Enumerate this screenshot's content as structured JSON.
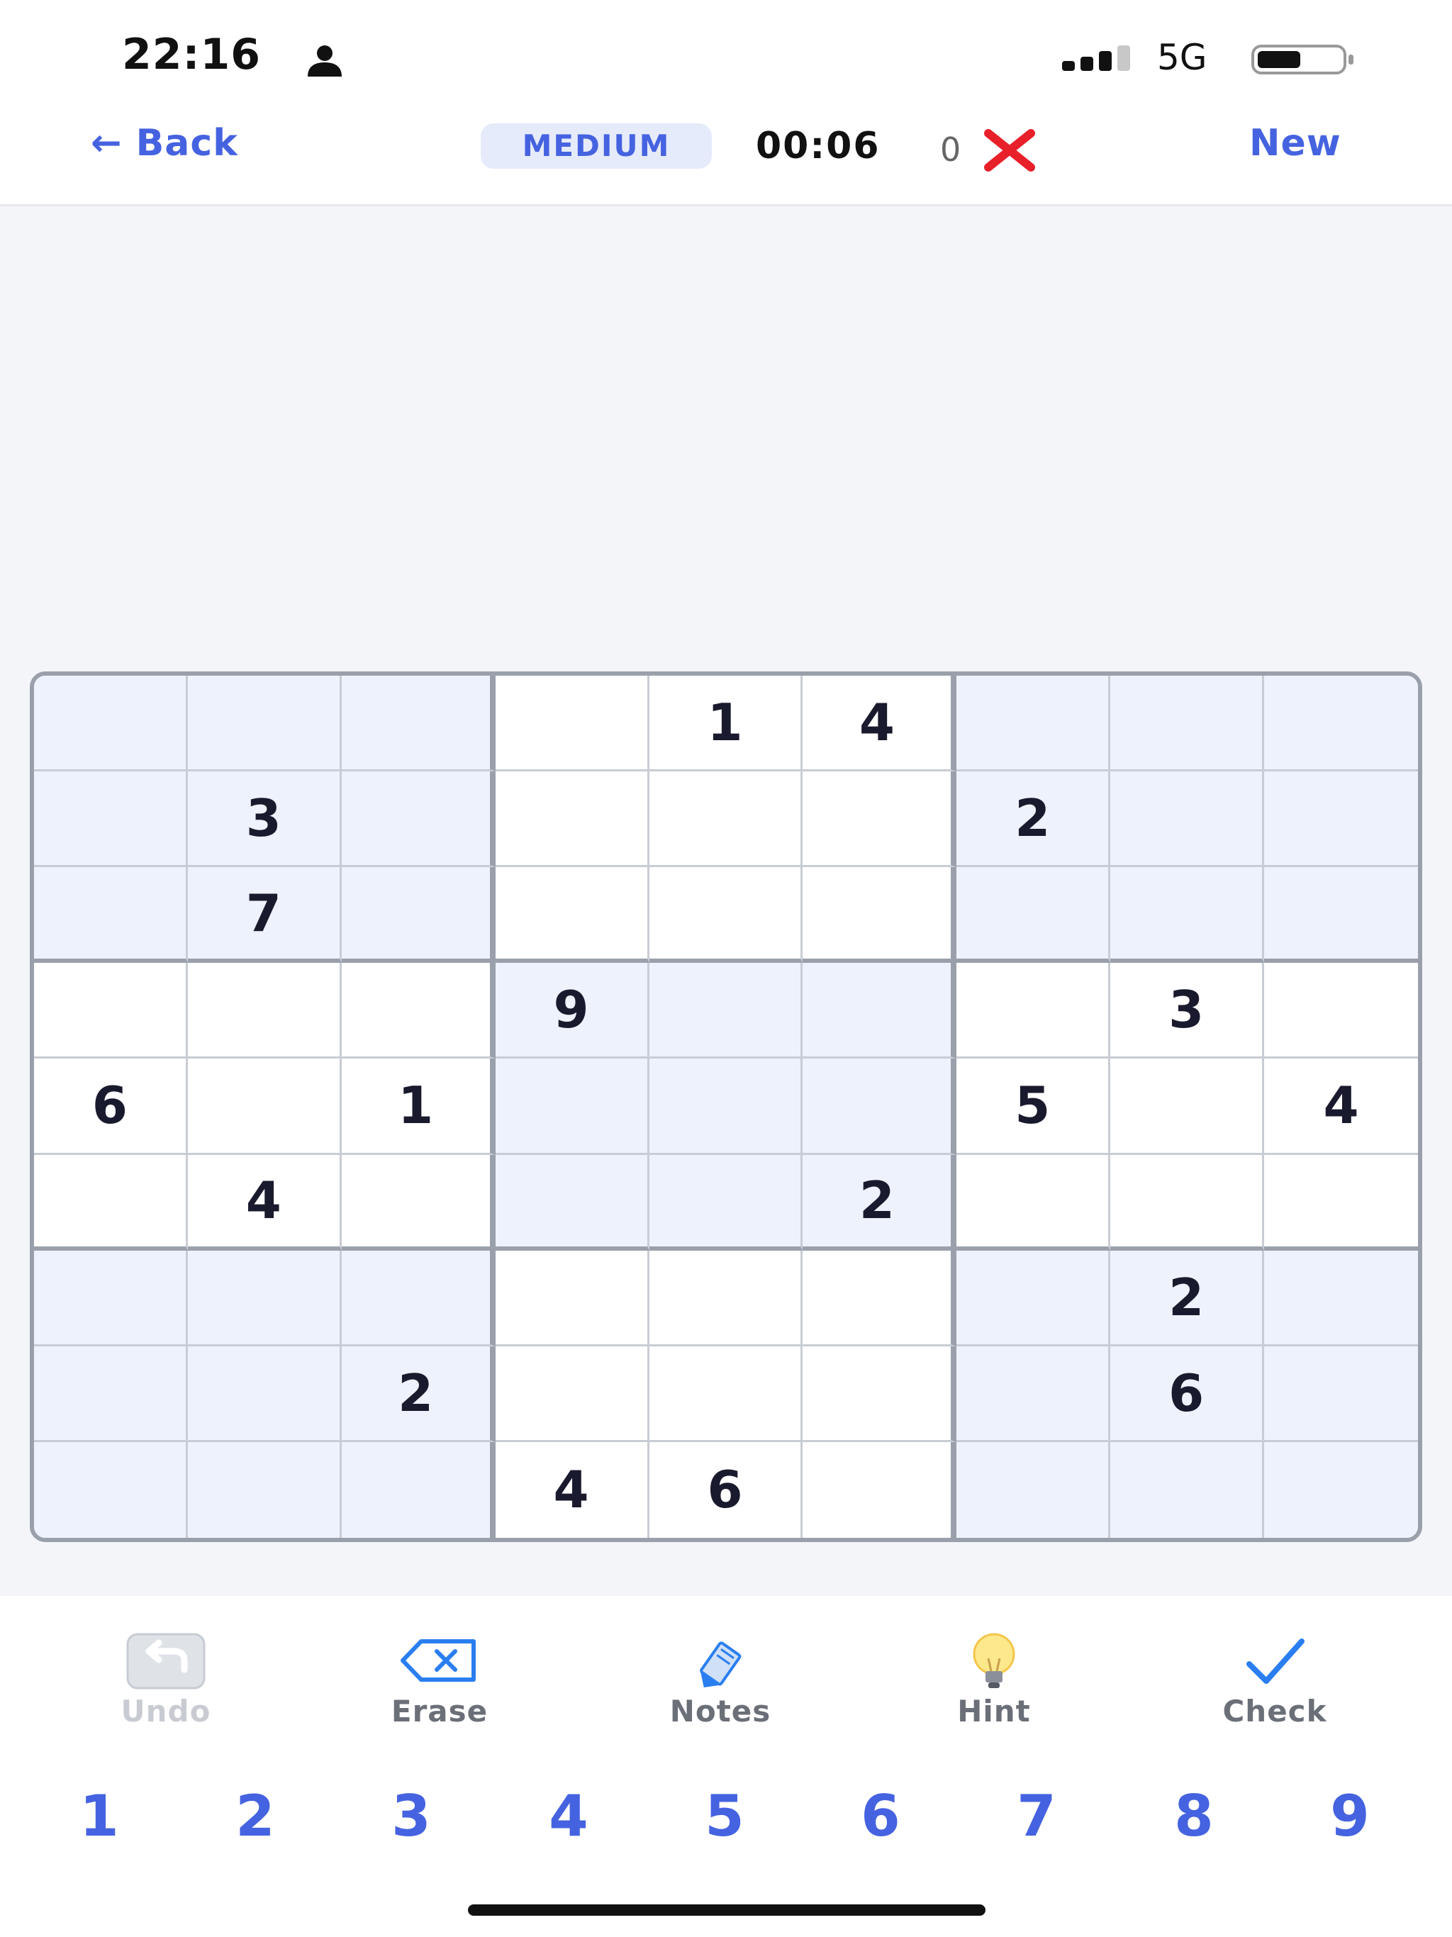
{
  "status_bar": {
    "time": "22:16",
    "network": "5G"
  },
  "header": {
    "back_label": "← Back",
    "difficulty": "MEDIUM",
    "timer": "00:06",
    "mistakes": "0",
    "new_label": "New"
  },
  "board": {
    "rows": [
      [
        "",
        "",
        "",
        "",
        "1",
        "4",
        "",
        "",
        ""
      ],
      [
        "",
        "3",
        "",
        "",
        "",
        "",
        "2",
        "",
        ""
      ],
      [
        "",
        "7",
        "",
        "",
        "",
        "",
        "",
        "",
        ""
      ],
      [
        "",
        "",
        "",
        "9",
        "",
        "",
        "",
        "3",
        ""
      ],
      [
        "6",
        "",
        "1",
        "",
        "",
        "",
        "5",
        "",
        "4"
      ],
      [
        "",
        "4",
        "",
        "",
        "",
        "2",
        "",
        "",
        ""
      ],
      [
        "",
        "",
        "",
        "",
        "",
        "",
        "",
        "2",
        ""
      ],
      [
        "",
        "",
        "2",
        "",
        "",
        "",
        "",
        "6",
        ""
      ],
      [
        "",
        "",
        "",
        "4",
        "6",
        "",
        "",
        "",
        ""
      ]
    ]
  },
  "colors": {
    "accent": "#4563e0",
    "shaded_cell": "#eef2fc",
    "error": "#e8202a"
  },
  "toolbar": {
    "undo_label": "Undo",
    "erase_label": "Erase",
    "notes_label": "Notes",
    "hint_label": "Hint",
    "check_label": "Check"
  },
  "numpad": [
    "1",
    "2",
    "3",
    "4",
    "5",
    "6",
    "7",
    "8",
    "9"
  ]
}
